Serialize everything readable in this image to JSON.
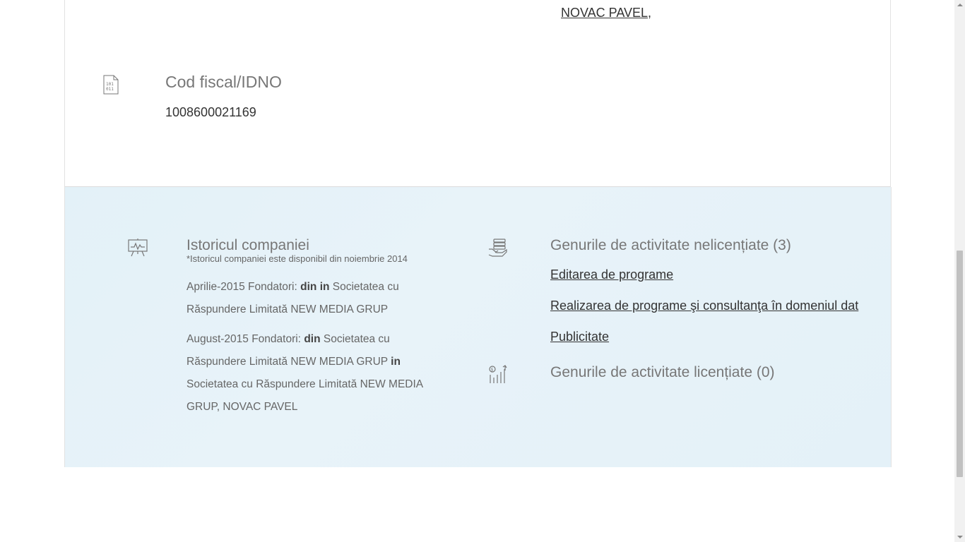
{
  "company_card": {
    "founder_link": "NOVAC PAVEL,",
    "fiscal_code": {
      "icon": "binary-file-icon",
      "title": "Cod fiscal/IDNO",
      "value": "1008600021169"
    }
  },
  "history": {
    "icon": "presentation-chart-icon",
    "title": "Istoricul companiei",
    "note": "*Istoricul companiei este disponibil din noiembrie 2014",
    "entries": [
      {
        "date_label": "Aprilie-2015 Fondatori:",
        "from_label": "din",
        "to_label": "in",
        "text": "Societatea cu Răspundere Limitată NEW MEDIA GRUP"
      },
      {
        "date_label": "August-2015 Fondatori:",
        "from_label": "din",
        "from_text": "Societatea cu Răspundere Limitată NEW MEDIA GRUP",
        "to_label": "in",
        "to_text": "Societatea cu Răspundere Limitată NEW MEDIA GRUP, NOVAC PAVEL"
      }
    ]
  },
  "unlicensed_activities": {
    "icon": "money-hand-icon",
    "title": "Genurile de activitate nelicențiate (3)",
    "items": [
      "Editarea de programe",
      "Realizarea de programe şi consultanţa în domeniul dat",
      "Publicitate"
    ]
  },
  "licensed_activities": {
    "icon": "growth-chart-icon",
    "title": "Genurile de activitate licențiate (0)"
  }
}
